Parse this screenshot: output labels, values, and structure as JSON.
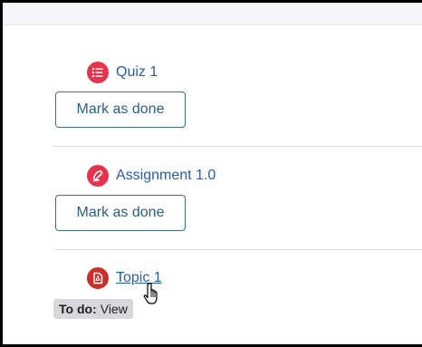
{
  "activities": [
    {
      "name": "Quiz 1",
      "icon": "quiz-icon",
      "button_label": "Mark as done"
    },
    {
      "name": "Assignment 1.0",
      "icon": "assignment-icon",
      "button_label": "Mark as done"
    },
    {
      "name": "Topic 1",
      "icon": "pdf-icon",
      "todo_label": "To do:",
      "todo_value": "View"
    }
  ],
  "colors": {
    "link": "#2a5d9f",
    "button_border": "#3c6f8a",
    "activity_icon": "#e8334d",
    "pdf_icon": "#c9302c",
    "badge_bg": "#d6d8db"
  },
  "cursor": "hand-pointer-icon"
}
